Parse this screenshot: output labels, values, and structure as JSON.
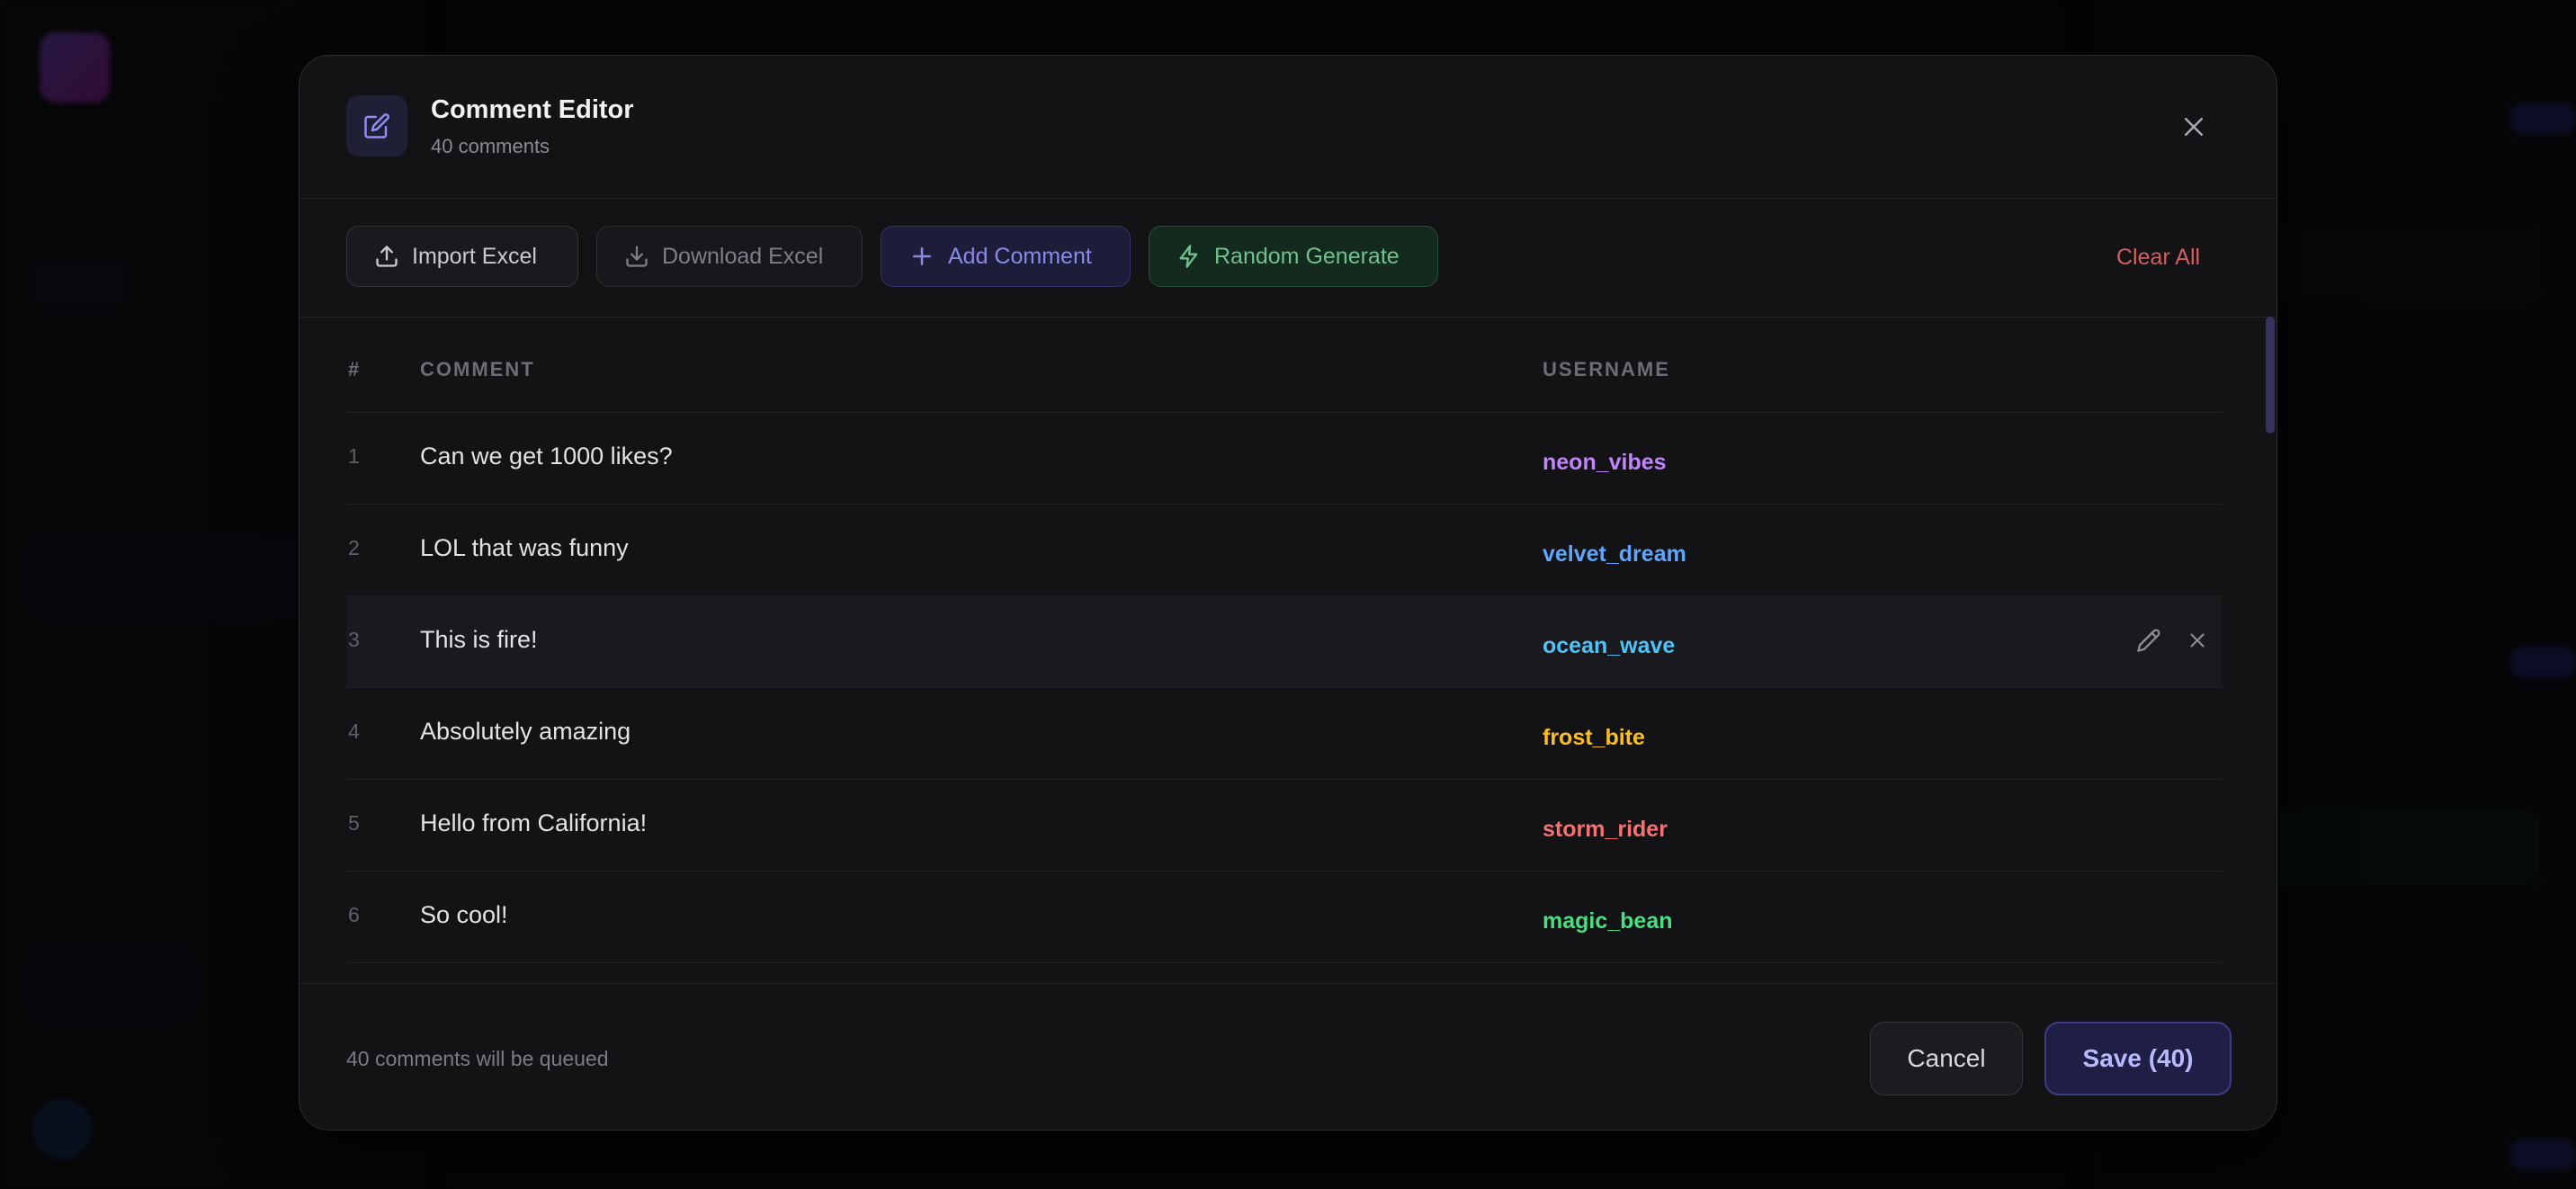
{
  "modal": {
    "title": "Comment Editor",
    "subtitle": "40 comments",
    "icon": "edit-square-icon",
    "close_icon": "close-icon"
  },
  "toolbar": {
    "import_label": "Import Excel",
    "download_label": "Download Excel",
    "add_label": "Add Comment",
    "random_label": "Random Generate",
    "clear_label": "Clear All"
  },
  "table": {
    "headers": {
      "num": "#",
      "comment": "COMMENT",
      "username": "USERNAME"
    },
    "rows": [
      {
        "num": "1",
        "comment": "Can we get 1000 likes?",
        "username": "neon_vibes",
        "color": "#c084fc"
      },
      {
        "num": "2",
        "comment": "LOL that was funny",
        "username": "velvet_dream",
        "color": "#60a5fa"
      },
      {
        "num": "3",
        "comment": "This is fire!",
        "username": "ocean_wave",
        "color": "#4fc3f7"
      },
      {
        "num": "4",
        "comment": "Absolutely amazing",
        "username": "frost_bite",
        "color": "#fbbf24"
      },
      {
        "num": "5",
        "comment": "Hello from California!",
        "username": "storm_rider",
        "color": "#f87171"
      },
      {
        "num": "6",
        "comment": "So cool!",
        "username": "magic_bean",
        "color": "#4ade80"
      }
    ]
  },
  "footer": {
    "note": "40 comments will be queued",
    "cancel_label": "Cancel",
    "save_label": "Save (40)"
  }
}
